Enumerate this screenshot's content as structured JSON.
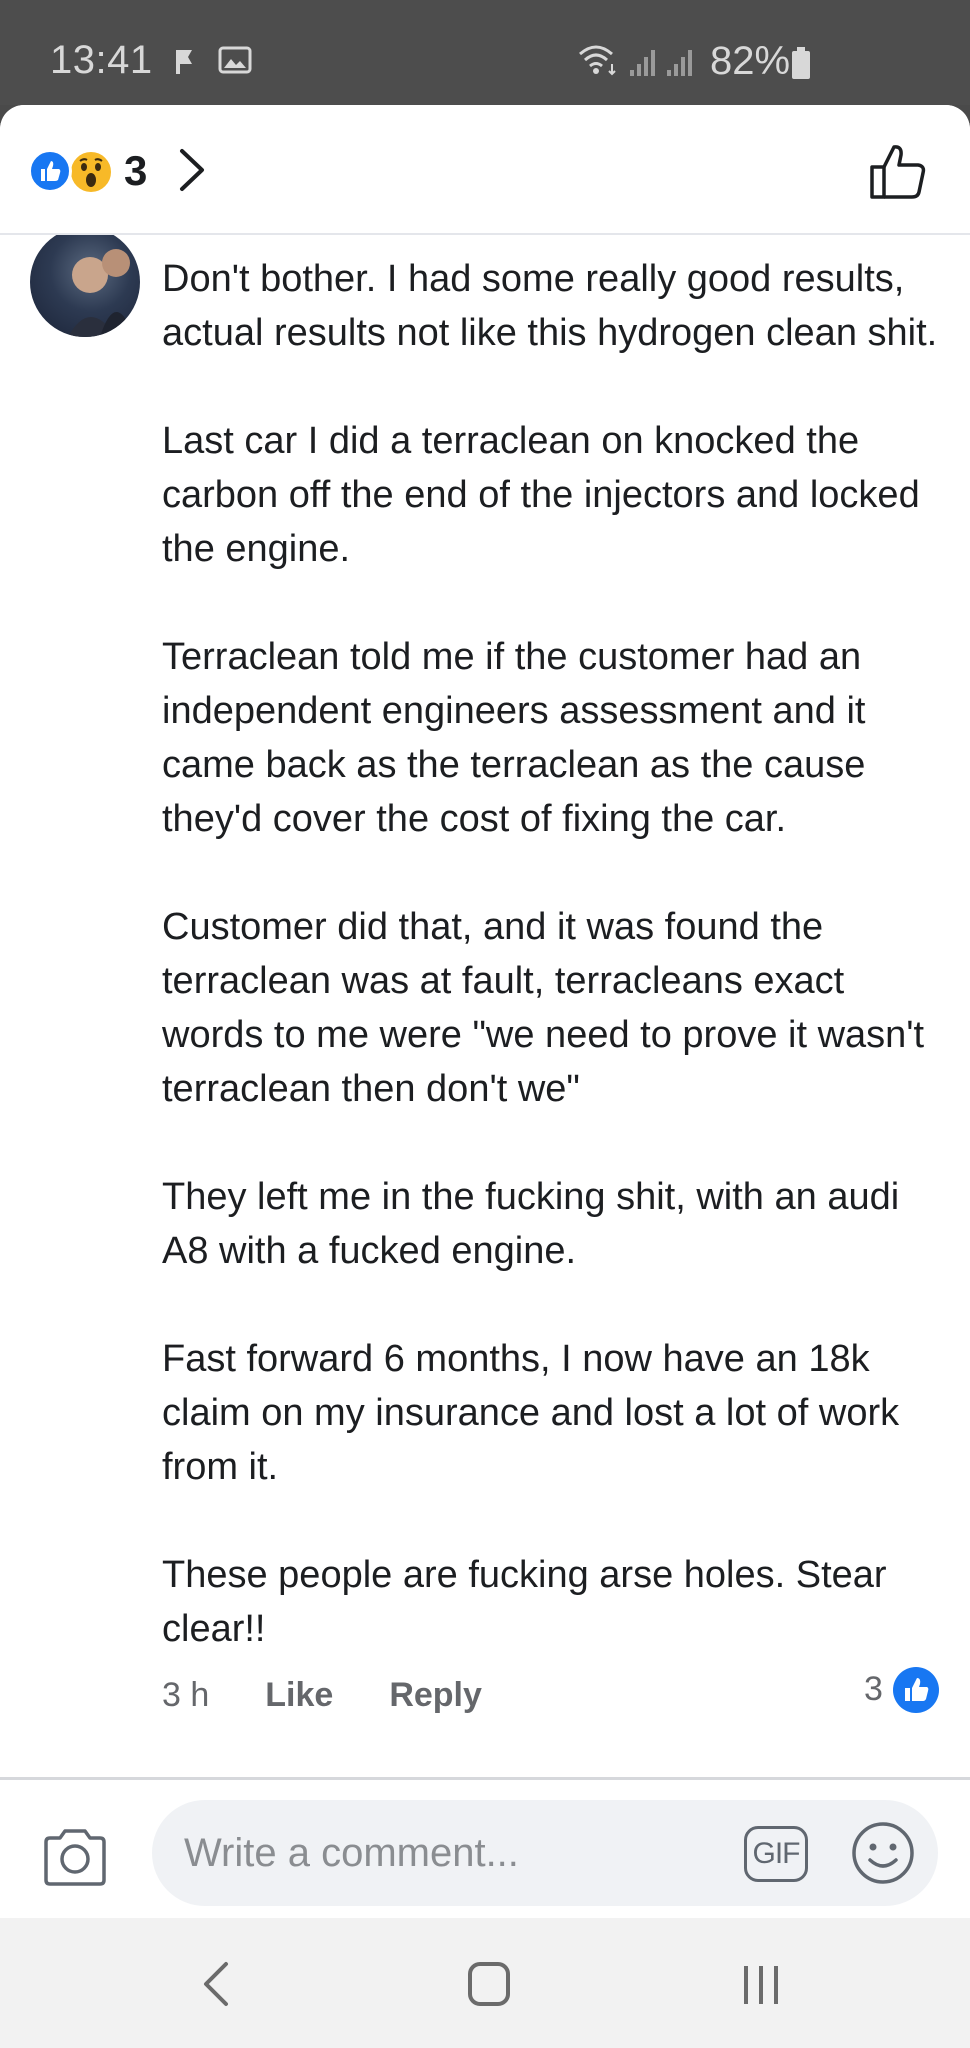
{
  "status_bar": {
    "time": "13:41",
    "battery": "82%",
    "icons": [
      "flag-icon",
      "image-icon",
      "wifi-icon",
      "signal-icon",
      "signal-icon",
      "battery-icon"
    ]
  },
  "reactions": {
    "count": "3",
    "types": [
      "like-reaction-icon",
      "wow-reaction-icon"
    ]
  },
  "comment": {
    "paragraphs": [
      "Don't bother. I had some really good results, actual results not like this hydrogen clean shit.",
      "Last car I did a terraclean on knocked the carbon off the end of the injectors and locked the engine.",
      "Terraclean told me if the customer had an independent engineers assessment and it came back as the terraclean as the cause they'd cover the cost of fixing the car.",
      "Customer did that, and it was found the terraclean was at fault, terracleans exact words to me were \"we need to prove it wasn't terraclean then don't we\"",
      "They left me in the fucking shit, with an audi A8 with a fucked engine.",
      "Fast forward 6 months, I now have an 18k claim on my insurance and lost a lot of work from it.",
      "These people are fucking arse holes. Stear clear!!"
    ],
    "time": "3 h",
    "like_label": "Like",
    "reply_label": "Reply",
    "like_count": "3"
  },
  "composer": {
    "placeholder": "Write a comment...",
    "gif_label": "GIF"
  },
  "colors": {
    "accent": "#1877f2",
    "wow": "#f7b928",
    "muted_text": "#65676b"
  }
}
